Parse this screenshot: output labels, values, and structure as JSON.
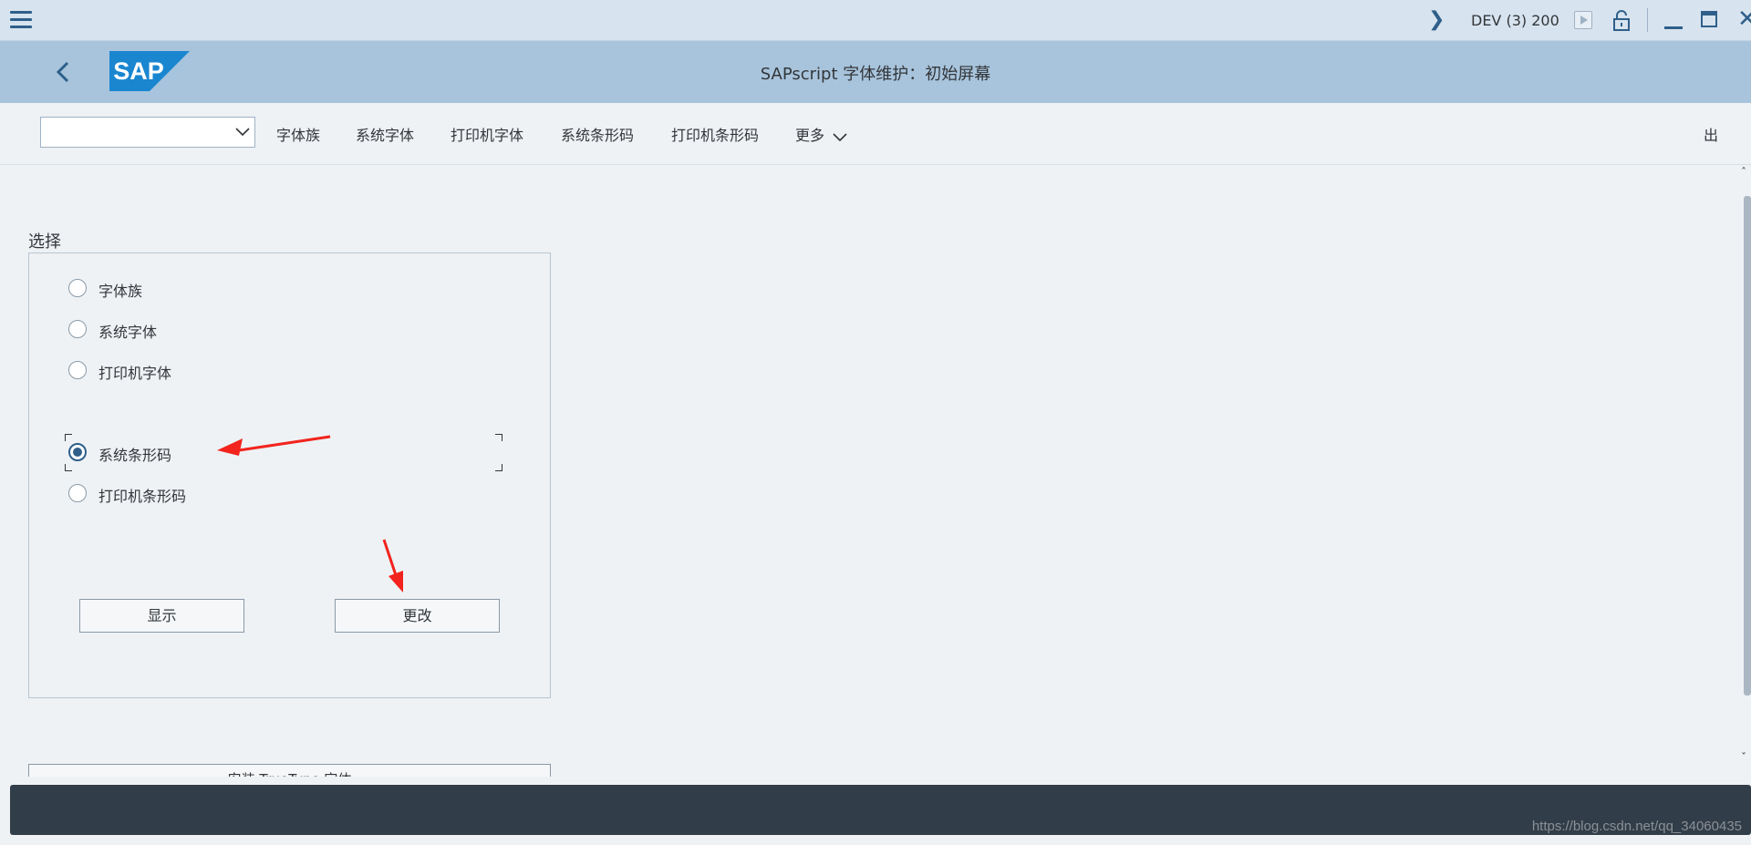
{
  "system": {
    "info": "DEV (3) 200"
  },
  "header": {
    "title": "SAPscript 字体维护：初始屏幕",
    "logo": "SAP"
  },
  "toolbar": {
    "command_value": "",
    "buttons": [
      "字体族",
      "系统字体",
      "打印机字体",
      "系统条形码",
      "打印机条形码"
    ],
    "more": "更多",
    "exit": "出"
  },
  "selection": {
    "title": "选择",
    "options": [
      "字体族",
      "系统字体",
      "打印机字体",
      "系统条形码",
      "打印机条形码"
    ],
    "selected_index": 3,
    "buttons": {
      "display": "显示",
      "change": "更改"
    },
    "partial_button": "安装 TrueType 字体"
  },
  "watermark": "https://blog.csdn.net/qq_34060435",
  "colors": {
    "accent": "#2f5f8a",
    "header_bg": "#a8c4dc",
    "annotation_arrow": "#f2241d"
  }
}
